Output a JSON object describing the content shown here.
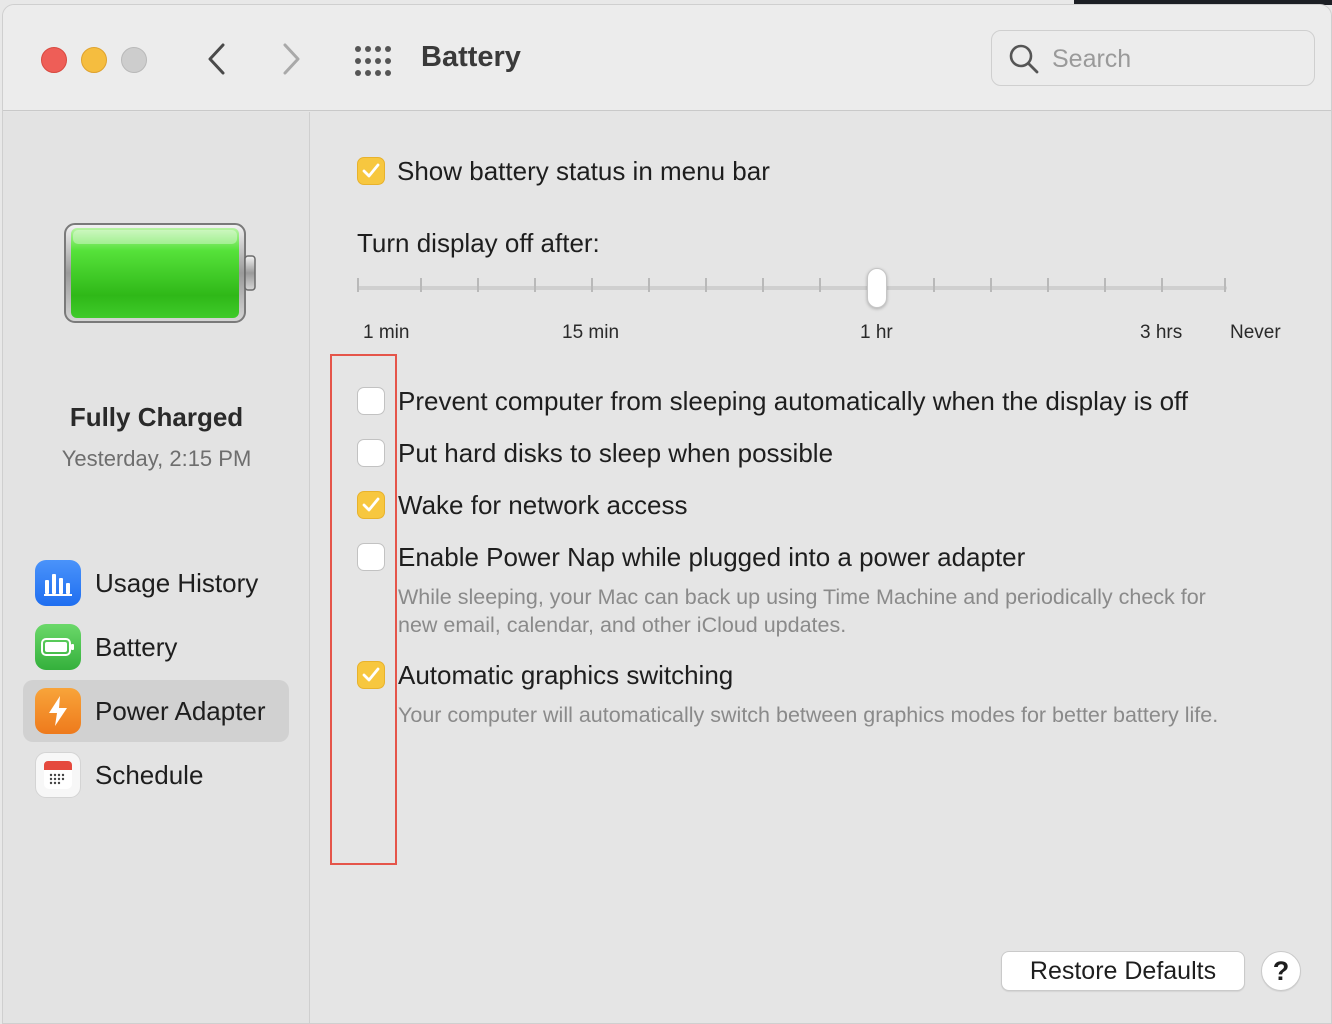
{
  "window": {
    "title": "Battery",
    "search_placeholder": "Search"
  },
  "sidebar": {
    "status_main": "Fully Charged",
    "status_sub": "Yesterday, 2:15 PM",
    "items": [
      {
        "label": "Usage History",
        "icon": "bar-chart-icon",
        "color": "#2f7bf5",
        "selected": false
      },
      {
        "label": "Battery",
        "icon": "battery-icon",
        "color": "#4cc35a",
        "selected": false
      },
      {
        "label": "Power Adapter",
        "icon": "lightning-icon",
        "color": "#f08c24",
        "selected": true
      },
      {
        "label": "Schedule",
        "icon": "calendar-icon",
        "color": "#e5493d",
        "selected": false
      }
    ]
  },
  "settings": {
    "show_status": {
      "label": "Show battery status in menu bar",
      "checked": true
    },
    "display_off": {
      "title": "Turn display off after:",
      "tick_labels": [
        "1 min",
        "15 min",
        "1 hr",
        "3 hrs",
        "Never"
      ],
      "value": "1 hr"
    },
    "options": [
      {
        "label": "Prevent computer from sleeping automatically when the display is off",
        "checked": false
      },
      {
        "label": "Put hard disks to sleep when possible",
        "checked": false
      },
      {
        "label": "Wake for network access",
        "checked": true
      },
      {
        "label": "Enable Power Nap while plugged into a power adapter",
        "checked": false,
        "description": [
          "While sleeping, your Mac can back up using Time Machine and periodically check for",
          "new email, calendar, and other iCloud updates."
        ]
      },
      {
        "label": "Automatic graphics switching",
        "checked": true,
        "description": [
          "Your computer will automatically switch between graphics modes for better battery life."
        ]
      }
    ]
  },
  "footer": {
    "restore_label": "Restore Defaults",
    "help_label": "?"
  },
  "colors": {
    "checkbox_accent": "#f7c73f",
    "highlight_box": "#e5554a"
  }
}
